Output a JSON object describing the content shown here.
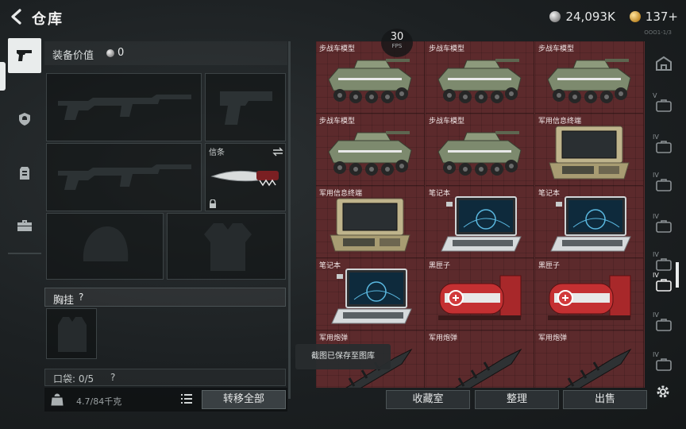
{
  "header": {
    "title": "仓库",
    "small_text": "ООО1-1/3"
  },
  "currency": [
    {
      "icon": "silver-coin-icon",
      "value": "24,093K"
    },
    {
      "icon": "gold-coin-icon",
      "value": "137+"
    }
  ],
  "left_nav": [
    {
      "icon": "pistol-icon",
      "active": true
    },
    {
      "icon": "helmet-badge-icon"
    },
    {
      "icon": "vest-icon"
    },
    {
      "icon": "briefcase-icon"
    }
  ],
  "equipment": {
    "value_label": "装备价值",
    "value": "0",
    "knife_slot_label": "信条",
    "chest_rig_label": "胸挂",
    "chest_rig_help": "?",
    "pocket_label": "口袋: 0/5",
    "pocket_help": "?",
    "weight": "4.7/84千克",
    "transfer_all_label": "转移全部"
  },
  "fps": {
    "value": "30",
    "label": "FPS"
  },
  "inventory": [
    {
      "name": "步战车模型",
      "type": "ifv"
    },
    {
      "name": "步战车模型",
      "type": "ifv"
    },
    {
      "name": "步战车模型",
      "type": "ifv"
    },
    {
      "name": "步战车模型",
      "type": "ifv"
    },
    {
      "name": "步战车模型",
      "type": "ifv"
    },
    {
      "name": "军用信息终端",
      "type": "terminal"
    },
    {
      "name": "军用信息终端",
      "type": "terminal"
    },
    {
      "name": "笔记本",
      "type": "laptop"
    },
    {
      "name": "笔记本",
      "type": "laptop"
    },
    {
      "name": "笔记本",
      "type": "laptop"
    },
    {
      "name": "黑匣子",
      "type": "blackbox"
    },
    {
      "name": "黑匣子",
      "type": "blackbox"
    },
    {
      "name": "军用炮弹",
      "type": "shell"
    },
    {
      "name": "军用炮弹",
      "type": "shell"
    },
    {
      "name": "军用炮弹",
      "type": "shell"
    }
  ],
  "toast": "截图已保存至图库",
  "actions": {
    "collection_label": "收藏室",
    "sort_label": "整理",
    "sell_label": "出售"
  },
  "right_nav": [
    {
      "icon": "home-icon",
      "level": ""
    },
    {
      "icon": "case-icon",
      "level": "V"
    },
    {
      "icon": "case-icon",
      "level": "IV"
    },
    {
      "icon": "case-icon",
      "level": "IV"
    },
    {
      "icon": "case-icon",
      "level": "IV"
    },
    {
      "icon": "case-icon",
      "level": "IV"
    },
    {
      "icon": "case-icon",
      "level": "IV",
      "active": true
    },
    {
      "icon": "case-icon",
      "level": "IV"
    },
    {
      "icon": "case-icon",
      "level": "IV"
    }
  ],
  "colors": {
    "grid_bg": "#5c2a2c",
    "accent": "#e9ecec"
  }
}
